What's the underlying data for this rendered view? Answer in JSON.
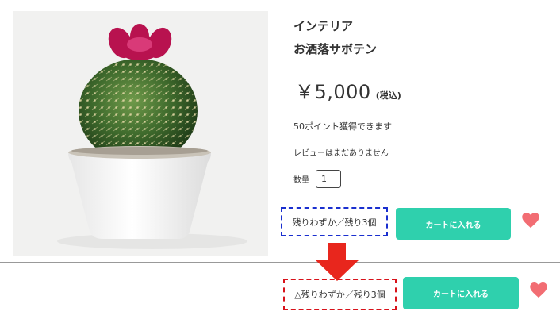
{
  "product": {
    "category": "インテリア",
    "name": "お洒落サボテン",
    "price": "￥5,000",
    "tax_label": "(税込)",
    "points_text": "50ポイント獲得できます",
    "review_text": "レビューはまだありません",
    "quantity_label": "数量",
    "quantity_value": "1"
  },
  "before": {
    "stock_text": "残りわずか／残り3個",
    "cart_button_label": "カートに入れる"
  },
  "after": {
    "stock_text": "△残りわずか／残り3個",
    "cart_button_label": "カートに入れる"
  },
  "icons": {
    "favorite": "heart-icon",
    "arrow": "arrow-down-icon"
  },
  "colors": {
    "cart_button": "#2fd0ad",
    "heart": "#f26d73",
    "arrow": "#e8261d",
    "highlight_before": "#1a2fcf",
    "highlight_after": "#d8121a"
  }
}
